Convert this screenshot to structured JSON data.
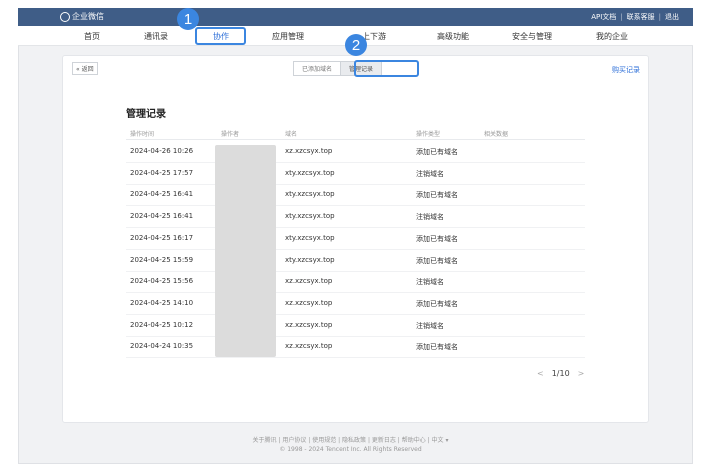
{
  "app": {
    "logo_text": "企业微信",
    "top_links": [
      "API文档",
      "联系客服",
      "退出"
    ]
  },
  "nav": {
    "items": [
      "首页",
      "通讯录",
      "协作",
      "应用管理",
      "上下游",
      "高级功能",
      "安全与管理",
      "我的企业"
    ],
    "partial_item": "上下游",
    "active": "协作"
  },
  "annotations": [
    "1",
    "2"
  ],
  "page": {
    "back_label": "« 返回",
    "tabs": [
      "已添加域名",
      "管理记录"
    ],
    "active_tab": "管理记录",
    "buy_label": "购买记录",
    "title": "管理记录"
  },
  "table": {
    "headers": [
      "操作时间",
      "操作者",
      "域名",
      "操作类型",
      "相关数据"
    ],
    "rows": [
      {
        "time": "2024-04-26 10:26",
        "domain": "xz.xzcsyx.top",
        "type": "添加已有域名"
      },
      {
        "time": "2024-04-25 17:57",
        "domain": "xty.xzcsyx.top",
        "type": "注销域名"
      },
      {
        "time": "2024-04-25 16:41",
        "domain": "xty.xzcsyx.top",
        "type": "添加已有域名"
      },
      {
        "time": "2024-04-25 16:41",
        "domain": "xty.xzcsyx.top",
        "type": "注销域名"
      },
      {
        "time": "2024-04-25 16:17",
        "domain": "xty.xzcsyx.top",
        "type": "添加已有域名"
      },
      {
        "time": "2024-04-25 15:59",
        "domain": "xty.xzcsyx.top",
        "type": "添加已有域名"
      },
      {
        "time": "2024-04-25 15:56",
        "domain": "xz.xzcsyx.top",
        "type": "注销域名"
      },
      {
        "time": "2024-04-25 14:10",
        "domain": "xz.xzcsyx.top",
        "type": "添加已有域名"
      },
      {
        "time": "2024-04-25 10:12",
        "domain": "xz.xzcsyx.top",
        "type": "注销域名"
      },
      {
        "time": "2024-04-24 10:35",
        "domain": "xz.xzcsyx.top",
        "type": "添加已有域名"
      }
    ]
  },
  "pager": {
    "prev": "<",
    "label": "1/10",
    "next": ">"
  },
  "footer": {
    "links": "关于腾讯 | 用户协议 | 使用规范 | 隐私政策 | 更新日志 | 帮助中心 | 中文 ▾",
    "copyright": "© 1998 - 2024 Tencent Inc. All Rights Reserved"
  }
}
